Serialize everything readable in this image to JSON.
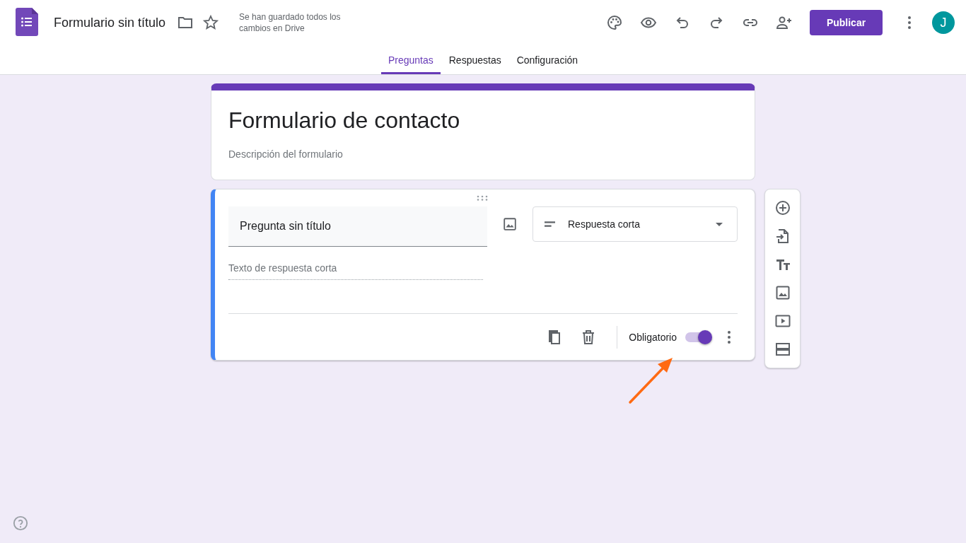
{
  "header": {
    "app_title": "Formulario sin título",
    "save_status": "Se han guardado todos los cambios en Drive",
    "publish_button": "Publicar",
    "avatar_initial": "J"
  },
  "tabs": [
    {
      "label": "Preguntas",
      "selected": true
    },
    {
      "label": "Respuestas",
      "selected": false
    },
    {
      "label": "Configuración",
      "selected": false
    }
  ],
  "form": {
    "title": "Formulario de contacto",
    "description_placeholder": "Descripción del formulario"
  },
  "question": {
    "title": "Pregunta sin título",
    "type": "Respuesta corta",
    "answer_placeholder": "Texto de respuesta corta",
    "required_label": "Obligatorio",
    "required": true
  }
}
